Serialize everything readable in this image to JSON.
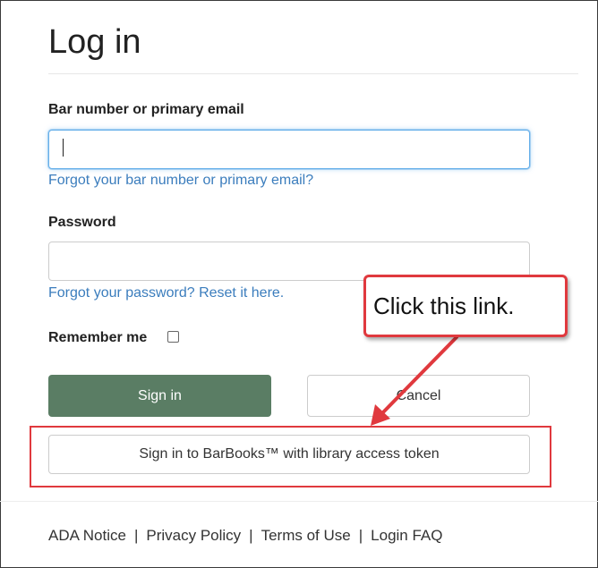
{
  "page": {
    "title": "Log in"
  },
  "form": {
    "login_label": "Bar number or primary email",
    "login_value": "",
    "forgot_login_link": "Forgot your bar number or primary email?",
    "password_label": "Password",
    "password_value": "",
    "forgot_password_link": "Forgot your password? Reset it here.",
    "remember_label": "Remember me",
    "remember_checked": false,
    "sign_in_button": "Sign in",
    "cancel_button": "Cancel",
    "token_button": "Sign in to BarBooks™ with library access token"
  },
  "annotation": {
    "callout_text": "Click this link.",
    "color": "#e0393e"
  },
  "footer": {
    "links": [
      "ADA Notice",
      "Privacy Policy",
      "Terms of Use",
      "Login FAQ"
    ],
    "separator": "|"
  },
  "colors": {
    "primary_button": "#5a7d64",
    "link": "#3b7dbd",
    "focus_border": "#66afe9"
  }
}
